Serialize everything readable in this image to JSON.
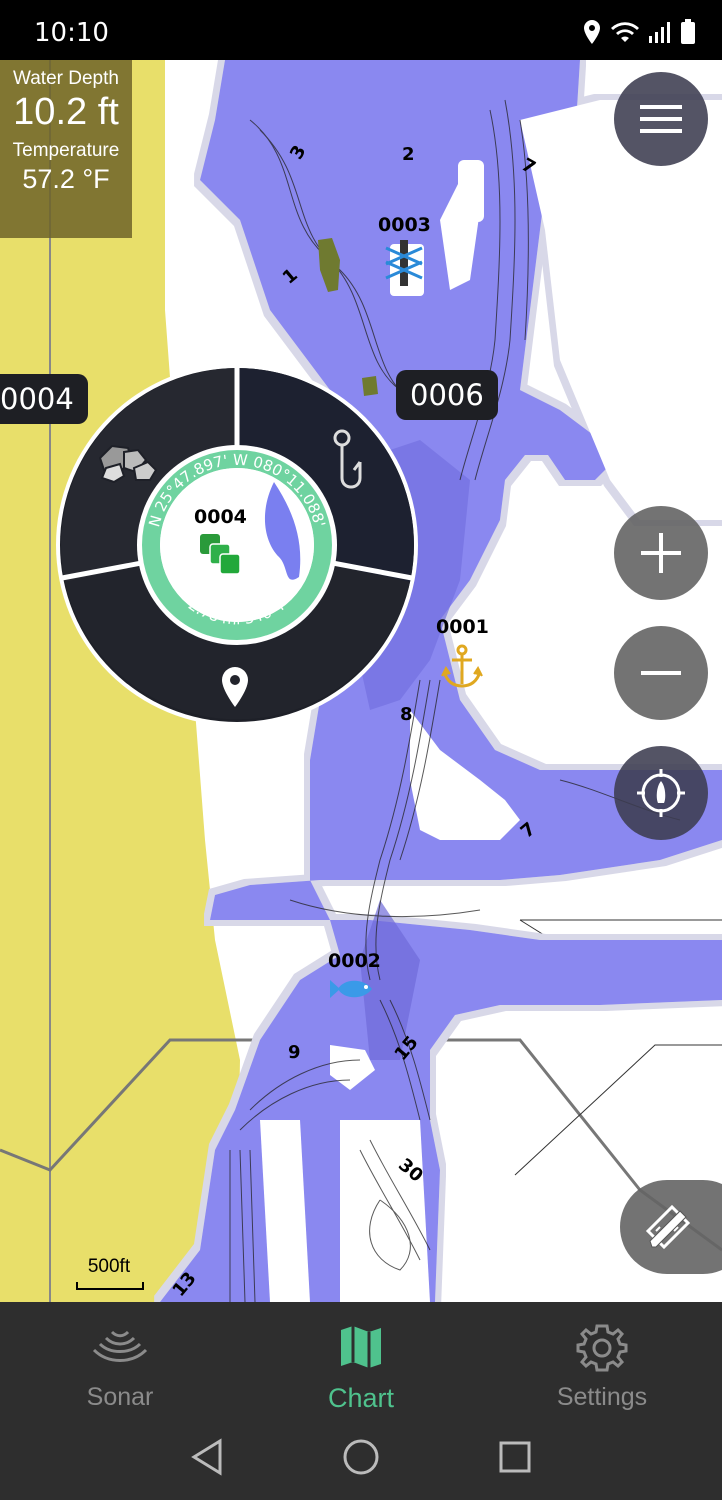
{
  "status_bar": {
    "time": "10:10"
  },
  "readout": {
    "depth_label": "Water Depth",
    "depth_value": "10.2 ft",
    "temp_label": "Temperature",
    "temp_value": "57.2 °F"
  },
  "waypoints": [
    {
      "id": "0003",
      "icon": "marker-icon"
    },
    {
      "id": "0001",
      "icon": "anchor-icon"
    },
    {
      "id": "0002",
      "icon": "fish-icon"
    }
  ],
  "tags": {
    "left": "0004",
    "right": "0006"
  },
  "radial_menu": {
    "waypoint_name": "0004",
    "coord_text": "N 25°47.897' W 080°11.088'",
    "distance_text": "2.78 mi 346°T",
    "segments": [
      "rocks-icon",
      "hook-icon",
      "pin-icon"
    ]
  },
  "depth_numbers": [
    "3",
    "2",
    "7",
    "1",
    "8",
    "7",
    "9",
    "15",
    "30",
    "13"
  ],
  "scale_label": "500ft",
  "bottom_nav": [
    {
      "label": "Sonar",
      "active": false
    },
    {
      "label": "Chart",
      "active": true
    },
    {
      "label": "Settings",
      "active": false
    }
  ],
  "colors": {
    "water": "#8a88f0",
    "land": "#e8df6a",
    "active": "#4fc28d"
  }
}
